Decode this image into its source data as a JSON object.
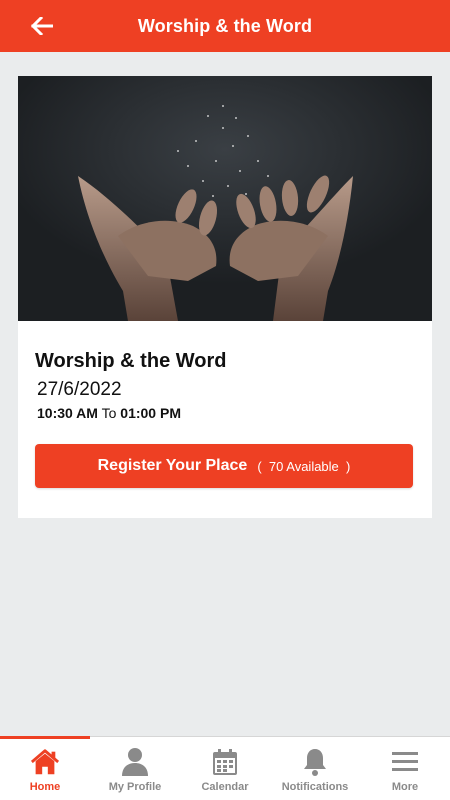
{
  "colors": {
    "accent": "#ee4023",
    "background": "#eaeced",
    "inactive": "#8a8a8a"
  },
  "header": {
    "title": "Worship & the Word",
    "back_icon": "arrow-left-icon"
  },
  "event": {
    "image": "praying-hands-photo",
    "title": "Worship & the Word",
    "date": "27/6/2022",
    "start_time": "10:30 AM",
    "to_label": "To",
    "end_time": "01:00 PM",
    "register_label": "Register Your Place",
    "available": "70 Available",
    "paren_open": "(",
    "paren_close": ")"
  },
  "tabs": [
    {
      "label": "Home",
      "icon": "home-icon",
      "active": true
    },
    {
      "label": "My Profile",
      "icon": "person-icon",
      "active": false
    },
    {
      "label": "Calendar",
      "icon": "calendar-icon",
      "active": false
    },
    {
      "label": "Notifications",
      "icon": "bell-icon",
      "active": false
    },
    {
      "label": "More",
      "icon": "menu-icon",
      "active": false
    }
  ]
}
